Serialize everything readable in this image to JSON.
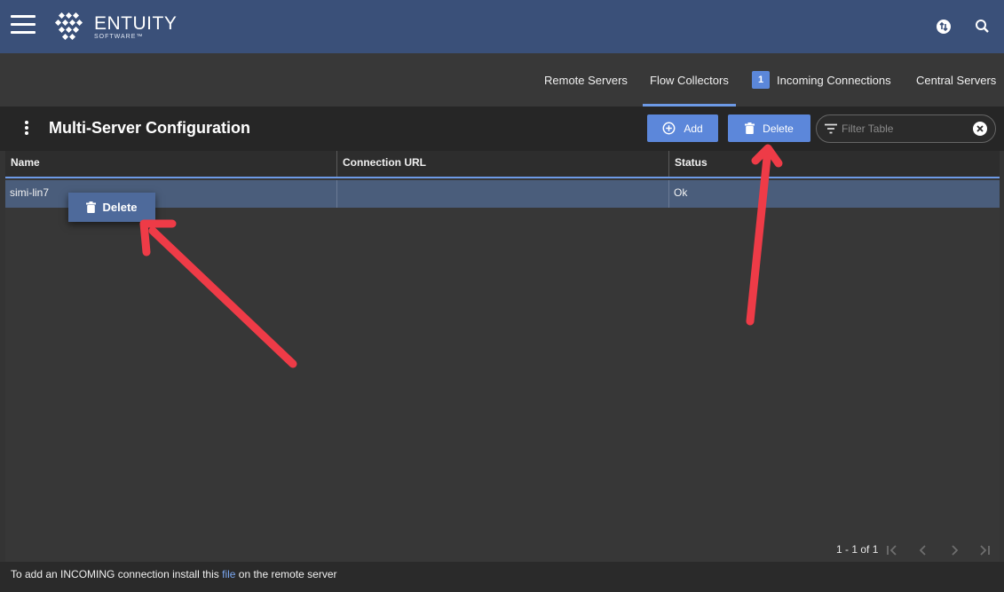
{
  "header": {
    "logo_main": "ENTUITY",
    "logo_sub": "SOFTWARE™",
    "icons": [
      "menu-icon",
      "entuity-logo-icon",
      "sync-icon",
      "search-icon"
    ]
  },
  "tabs": [
    {
      "label": "Remote Servers",
      "active": false
    },
    {
      "label": "Flow Collectors",
      "active": true
    },
    {
      "label": "Incoming Connections",
      "badge": "1",
      "active": false
    },
    {
      "label": "Central Servers",
      "active": false
    }
  ],
  "toolbar": {
    "title": "Multi-Server Configuration",
    "add_label": "Add",
    "delete_label": "Delete",
    "filter_placeholder": "Filter Table"
  },
  "table": {
    "columns": [
      "Name",
      "Connection URL",
      "Status"
    ],
    "rows": [
      {
        "name": "simi-lin7",
        "url": "",
        "status": "Ok"
      }
    ]
  },
  "context_menu": {
    "delete_label": "Delete"
  },
  "pagination": {
    "label": "1 - 1 of 1"
  },
  "footer": {
    "text_before": "To add an INCOMING connection install this ",
    "link": "file",
    "text_after": " on the remote server"
  },
  "colors": {
    "header_bg": "#3a5079",
    "accent": "#5c87da",
    "annotation_arrow": "#ee3b47"
  }
}
